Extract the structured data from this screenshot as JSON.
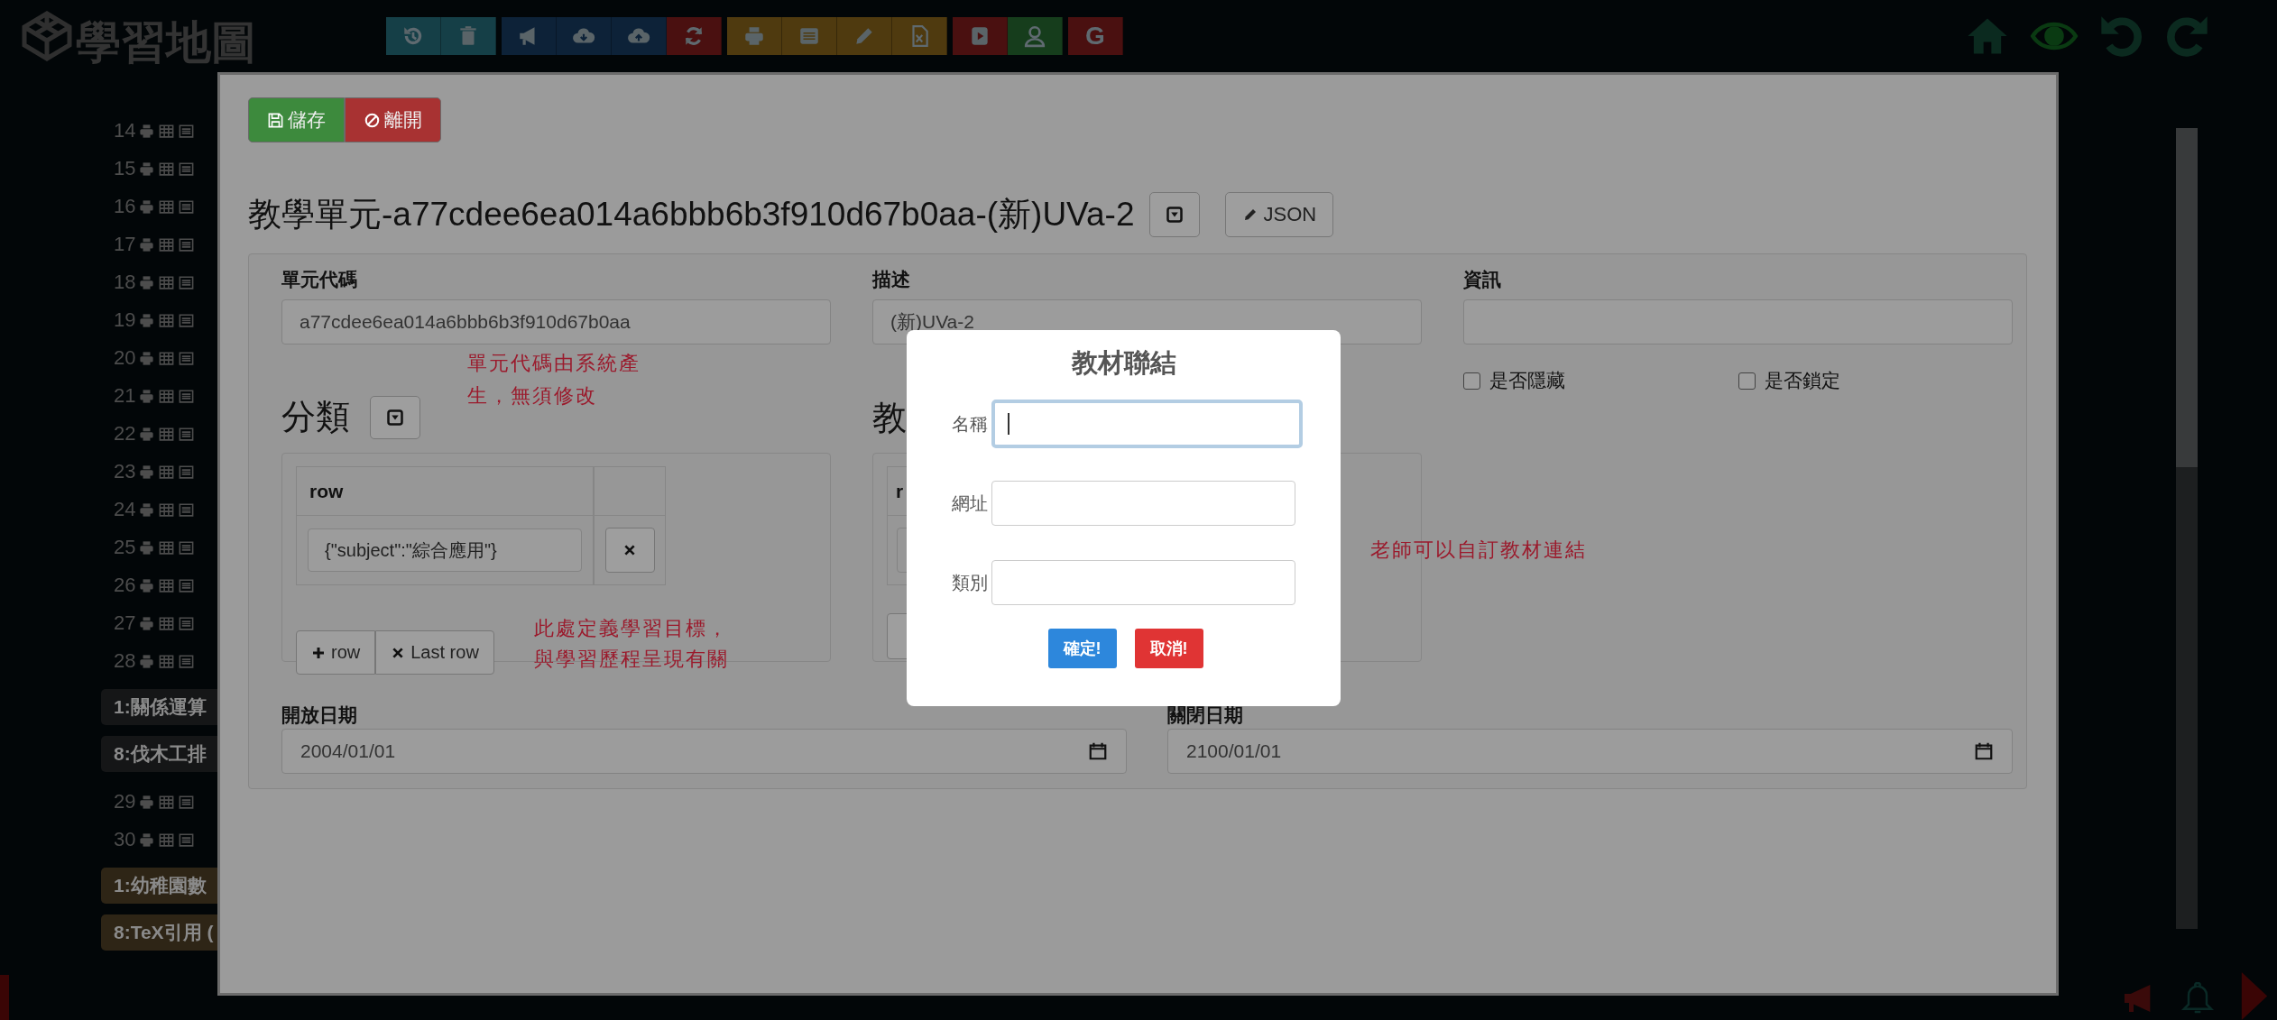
{
  "app": {
    "logo": "學習地圖"
  },
  "toolbar": [
    {
      "kind": "history",
      "color": "#153f47"
    },
    {
      "kind": "trash",
      "color": "#153f47"
    },
    {
      "kind": "megaphone",
      "color": "#0d2238"
    },
    {
      "kind": "cloud-download",
      "color": "#0d2238"
    },
    {
      "kind": "cloud-upload",
      "color": "#0d2238"
    },
    {
      "kind": "refresh",
      "color": "#4a1010"
    },
    {
      "kind": "print",
      "color": "#4f3a0f"
    },
    {
      "kind": "list",
      "color": "#4f3a0f"
    },
    {
      "kind": "pencil",
      "color": "#4f3a0f"
    },
    {
      "kind": "excel",
      "color": "#4f3a0f"
    },
    {
      "kind": "youtube",
      "color": "#4a1010"
    },
    {
      "kind": "user",
      "color": "#163d1c"
    },
    {
      "kind": "text",
      "label": "G",
      "color": "#4a1010"
    }
  ],
  "sidebar": {
    "items": [
      {
        "kind": "row",
        "number": "14"
      },
      {
        "kind": "row",
        "number": "15"
      },
      {
        "kind": "row",
        "number": "16"
      },
      {
        "kind": "row",
        "number": "17"
      },
      {
        "kind": "row",
        "number": "18"
      },
      {
        "kind": "row",
        "number": "19"
      },
      {
        "kind": "row",
        "number": "20"
      },
      {
        "kind": "row",
        "number": "21"
      },
      {
        "kind": "row",
        "number": "22"
      },
      {
        "kind": "row",
        "number": "23"
      },
      {
        "kind": "row",
        "number": "24"
      },
      {
        "kind": "row",
        "number": "25"
      },
      {
        "kind": "row",
        "number": "26"
      },
      {
        "kind": "row",
        "number": "27"
      },
      {
        "kind": "row",
        "number": "28"
      },
      {
        "kind": "block",
        "label": "1:關係運算",
        "color": "#151617"
      },
      {
        "kind": "block",
        "label": "8:伐木工排",
        "color": "#151617"
      },
      {
        "kind": "row",
        "number": "29"
      },
      {
        "kind": "row",
        "number": "30"
      },
      {
        "kind": "block",
        "label": "1:幼稚園數",
        "color": "#2e2516"
      },
      {
        "kind": "block",
        "label": "8:TeX引用 (",
        "color": "#2e2516"
      }
    ]
  },
  "modal": {
    "buttons": [
      {
        "kind": "save",
        "label": "儲存"
      },
      {
        "kind": "leave",
        "label": "離開"
      }
    ],
    "title": "教學單元-a77cdee6ea014a6bbb6b3f910d67b0aa-(新)UVa-2",
    "json_button": "JSON",
    "fields": [
      {
        "label": "單元代碼",
        "value": "a77cdee6ea014a6bbb6b3f910d67b0aa"
      },
      {
        "label": "描述",
        "value": "(新)UVa-2"
      },
      {
        "label": "資訊"
      }
    ],
    "code_note": "單元代碼由系統產生，無須修改",
    "checkboxes": [
      {
        "label": "是否隱藏",
        "checked": false
      },
      {
        "label": "是否鎖定",
        "checked": false
      }
    ],
    "category": {
      "heading": "分類",
      "column": "row",
      "rows": [
        "{\"subject\":\"綜合應用\"}"
      ],
      "buttons": [
        {
          "kind": "add",
          "label": "row"
        },
        {
          "kind": "remove",
          "label": "Last row"
        }
      ],
      "note": "此處定義學習目標，與學習歷程呈現有關"
    },
    "materials": {
      "heading": "教",
      "column": "r"
    },
    "materials_note": "老師可以自訂教材連結",
    "dates": [
      {
        "label": "開放日期",
        "value": "2004/01/01"
      },
      {
        "label": "關閉日期",
        "value": "2100/01/01"
      }
    ]
  },
  "dialog": {
    "title": "教材聯結",
    "fields": [
      {
        "label": "名稱",
        "focused": true
      },
      {
        "label": "網址",
        "focused": false
      },
      {
        "label": "類別",
        "focused": false
      }
    ],
    "buttons": [
      {
        "kind": "confirm",
        "label": "確定!"
      },
      {
        "kind": "cancel",
        "label": "取消!"
      }
    ]
  }
}
